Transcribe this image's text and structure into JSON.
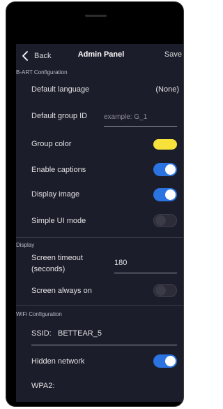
{
  "header": {
    "back_label": "Back",
    "title": "Admin Panel",
    "save_label": "Save"
  },
  "sections": {
    "bart": {
      "label": "B-ART Configuration",
      "default_language_label": "Default language",
      "default_language_value": "(None)",
      "default_group_label": "Default group ID",
      "default_group_placeholder": "example: G_1",
      "default_group_value": "",
      "group_color_label": "Group color",
      "group_color": "#f7e23c",
      "enable_captions_label": "Enable captions",
      "enable_captions_on": true,
      "display_image_label": "Display image",
      "display_image_on": true,
      "simple_ui_label": "Simple UI mode",
      "simple_ui_on": false
    },
    "display": {
      "label": "Display",
      "screen_timeout_label_line1": "Screen timeout",
      "screen_timeout_label_line2": "(seconds)",
      "screen_timeout_value": "180",
      "screen_always_on_label": "Screen always on",
      "screen_always_on": false
    },
    "wifi": {
      "label": "WiFi Configuration",
      "ssid_label": "SSID:",
      "ssid_value": "BETTEAR_5",
      "hidden_network_label": "Hidden network",
      "hidden_network_on": true,
      "wpa2_label": "WPA2:"
    }
  },
  "colors": {
    "accent": "#2a73e0",
    "background": "#1c1d2b",
    "group_color": "#f7e23c"
  }
}
